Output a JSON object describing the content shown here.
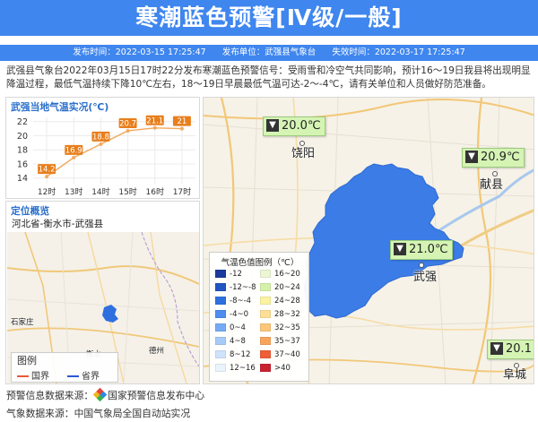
{
  "header": {
    "title": "寒潮蓝色预警[Ⅳ级/一般]"
  },
  "meta": {
    "publish_time_label": "发布时间：",
    "publish_time": "2022-03-15 17:25:47",
    "publisher_label": "发布单位：",
    "publisher": "武强县气象台",
    "expire_label": "失效时间：",
    "expire_time": "2022-03-17 17:25:47"
  },
  "intro": "武强县气象台2022年03月15日17时22分发布寒潮蓝色预警信号：受雨雪和冷空气共同影响，预计16～19日我县将出现明显降温过程，最低气温持续下降10℃左右，18～19日早晨最低气温可达-2～-4℃，请有关单位和人员做好防范准备。",
  "colors": {
    "header_bg": "#3f86ee",
    "warning_area": "#3b7ce6",
    "chart_line": "#f2a95d",
    "chart_label_bg": "#e87f1d",
    "legend_last": "#ffffff"
  },
  "temp_panel": {
    "title": "武强当地气温实况(℃)"
  },
  "chart_data": {
    "type": "line",
    "title": "武强当地气温实况(℃)",
    "categories": [
      "12时",
      "13时",
      "14时",
      "15时",
      "16时",
      "17时"
    ],
    "values": [
      14.2,
      16.9,
      18.8,
      20.7,
      21.1,
      21
    ],
    "value_labels": [
      "14.2",
      "16.9",
      "18.8",
      "20.7",
      "21.1",
      "21"
    ],
    "yticks": [
      14,
      16,
      18,
      20,
      22
    ],
    "ylim": [
      13.2,
      22.6
    ],
    "grid": true,
    "legend": "none"
  },
  "location": {
    "title": "定位概览",
    "path": "河北省-衡水市-武强县",
    "map_labels": [
      {
        "text": "石家庄"
      },
      {
        "text": "衡水"
      },
      {
        "text": "德州"
      }
    ],
    "legend": {
      "title": "图例",
      "items": [
        {
          "label": "国界",
          "color": "#e85b3a"
        },
        {
          "label": "省界",
          "color": "#2c57d8"
        }
      ]
    }
  },
  "map": {
    "temp_boxes": [
      {
        "value": "20.0℃",
        "icon": "down-arrow-icon"
      },
      {
        "value": "20.9℃",
        "icon": "down-arrow-icon"
      },
      {
        "value": "21.0℃",
        "icon": "down-arrow-icon"
      },
      {
        "value": "20.1",
        "icon": "down-arrow-icon"
      }
    ],
    "cities": [
      {
        "name": "饶阳"
      },
      {
        "name": "献县"
      },
      {
        "name": "武强"
      },
      {
        "name": "阜城"
      }
    ],
    "legend_title": "气温色值图例（℃）",
    "legend_items": [
      {
        "label": "-12",
        "color": "#1b3a9e"
      },
      {
        "label": "16~20",
        "color": "#ecf6d4"
      },
      {
        "label": "-12~-8",
        "color": "#2254c2"
      },
      {
        "label": "20~24",
        "color": "#d6f1aa"
      },
      {
        "label": "-8~-4",
        "color": "#2f70de"
      },
      {
        "label": "24~28",
        "color": "#fbf3a2"
      },
      {
        "label": "-4~0",
        "color": "#4d8ef0"
      },
      {
        "label": "28~32",
        "color": "#fde096"
      },
      {
        "label": "0~4",
        "color": "#75abf4"
      },
      {
        "label": "32~35",
        "color": "#fcc67b"
      },
      {
        "label": "4~8",
        "color": "#a6cbf8"
      },
      {
        "label": "35~37",
        "color": "#f7a55d"
      },
      {
        "label": "8~12",
        "color": "#cfe3fb"
      },
      {
        "label": "37~40",
        "color": "#ee5f3a"
      },
      {
        "label": "12~16",
        "color": "#e9f4fd"
      },
      {
        "label": ">40",
        "color": "#c8222f"
      }
    ]
  },
  "footer": {
    "warning_source": "预警信息数据来源：",
    "warning_source_name": "国家预警信息发布中心",
    "weather_source": "气象数据来源：中国气象局全国自动站实况"
  }
}
